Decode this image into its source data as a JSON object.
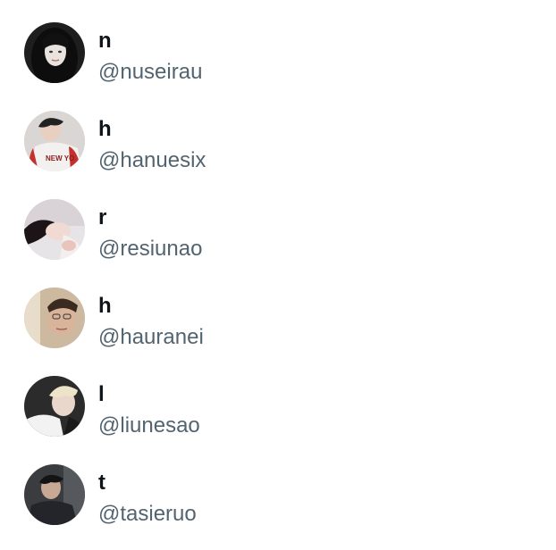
{
  "users": [
    {
      "name": "n",
      "handle": "@nuseirau",
      "avatar": "avatar-dark-hair-girl"
    },
    {
      "name": "h",
      "handle": "@hanuesix",
      "avatar": "avatar-new-york-shirt"
    },
    {
      "name": "r",
      "handle": "@resiunao",
      "avatar": "avatar-lying-down"
    },
    {
      "name": "h",
      "handle": "@hauranei",
      "avatar": "avatar-selfie"
    },
    {
      "name": "l",
      "handle": "@liunesao",
      "avatar": "avatar-blond-hair"
    },
    {
      "name": "t",
      "handle": "@tasieruo",
      "avatar": "avatar-dark-jacket"
    }
  ]
}
